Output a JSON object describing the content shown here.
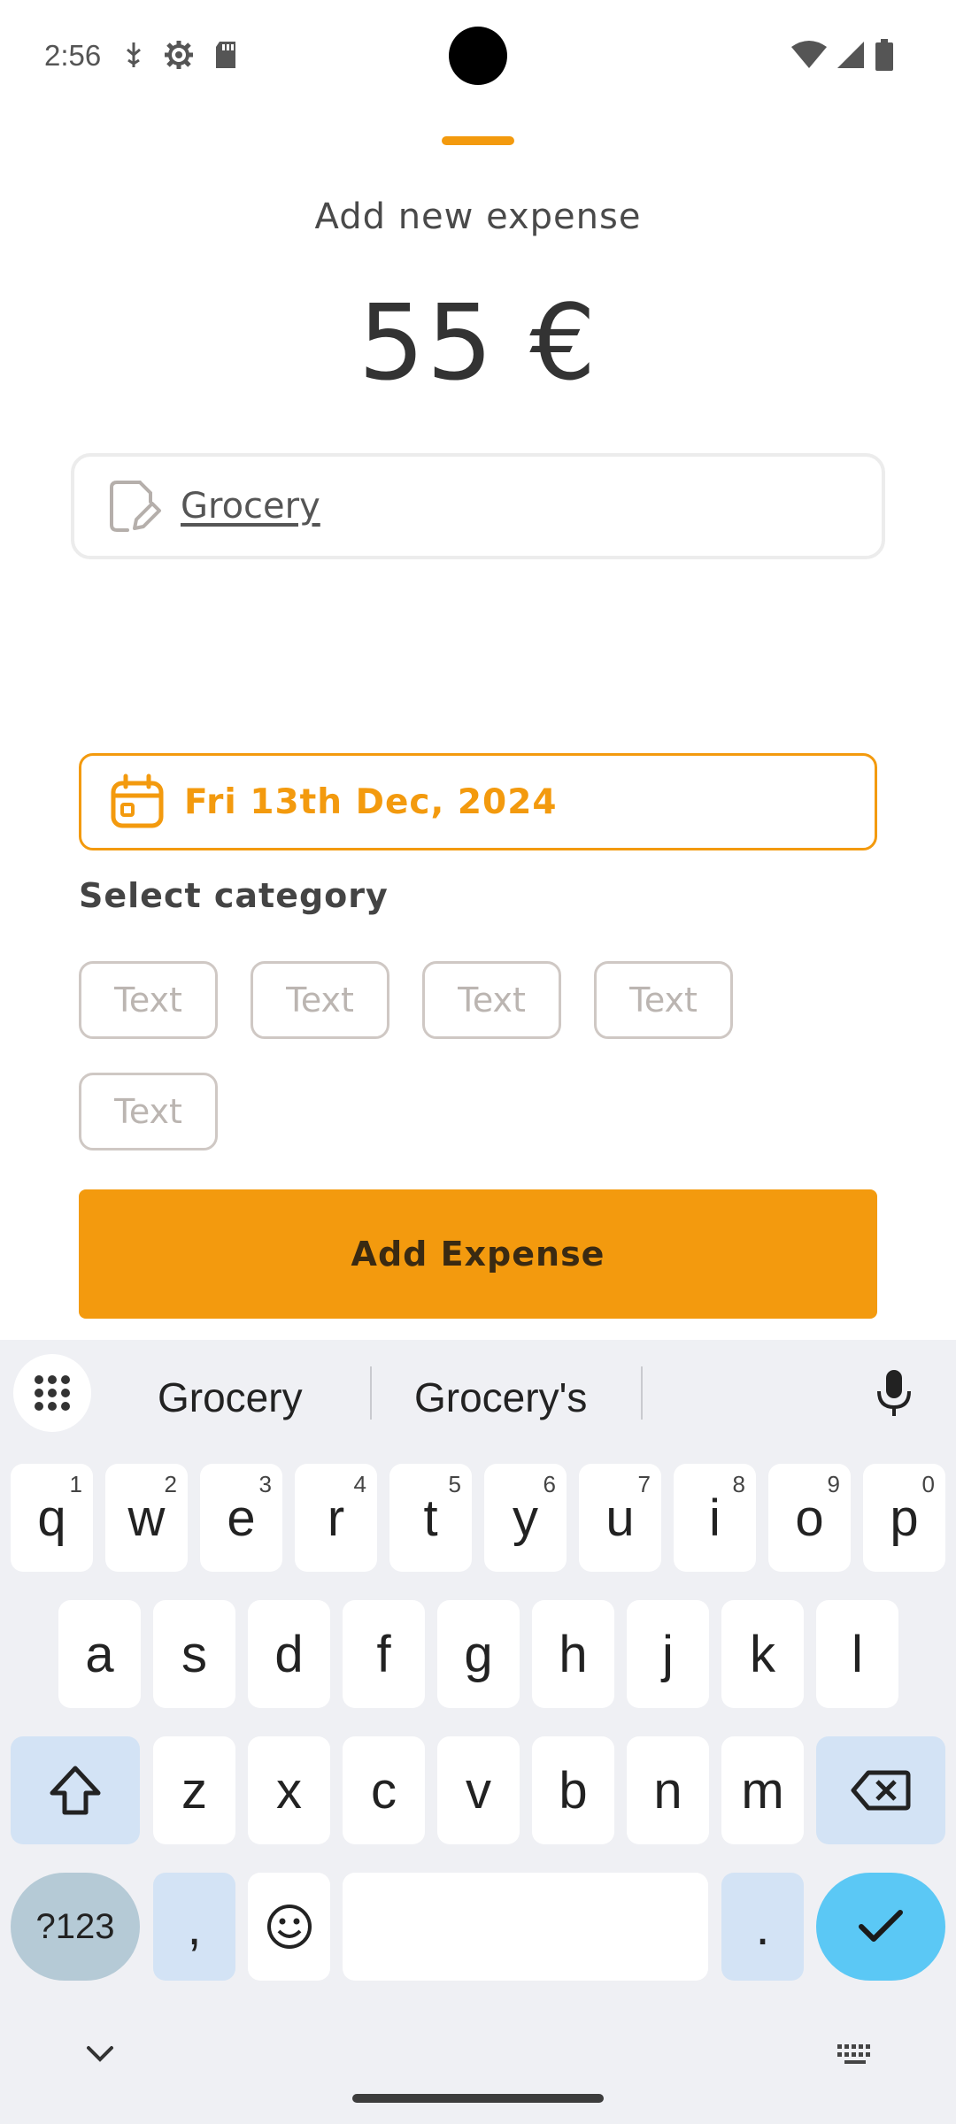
{
  "status_bar": {
    "time": "2:56"
  },
  "sheet": {
    "title": "Add new expense",
    "amount": "55 €",
    "note_value": "Grocery",
    "date": "Fri 13th Dec, 2024",
    "category_label": "Select category",
    "category_chips": [
      "Text",
      "Text",
      "Text",
      "Text",
      "Text"
    ],
    "submit_label": "Add Expense"
  },
  "keyboard": {
    "suggestions": [
      "Grocery",
      "Grocery's"
    ],
    "row1": [
      {
        "key": "q",
        "hint": "1"
      },
      {
        "key": "w",
        "hint": "2"
      },
      {
        "key": "e",
        "hint": "3"
      },
      {
        "key": "r",
        "hint": "4"
      },
      {
        "key": "t",
        "hint": "5"
      },
      {
        "key": "y",
        "hint": "6"
      },
      {
        "key": "u",
        "hint": "7"
      },
      {
        "key": "i",
        "hint": "8"
      },
      {
        "key": "o",
        "hint": "9"
      },
      {
        "key": "p",
        "hint": "0"
      }
    ],
    "row2": [
      "a",
      "s",
      "d",
      "f",
      "g",
      "h",
      "j",
      "k",
      "l"
    ],
    "row3": [
      "z",
      "x",
      "c",
      "v",
      "b",
      "n",
      "m"
    ],
    "symbols_label": "?123",
    "comma": ",",
    "period": "."
  },
  "colors": {
    "accent": "#f39a0e",
    "chip_border": "#cfc8c4",
    "keyboard_bg": "#eff0f4",
    "enter_key": "#5bc8f5"
  },
  "icons": {
    "note": "note-edit-icon",
    "date": "calendar-icon",
    "keyboard_menu": "grid-icon",
    "voice": "mic-icon",
    "shift": "shift-icon",
    "delete": "backspace-icon",
    "emoji": "emoji-icon",
    "enter": "check-icon",
    "hide": "chevron-down-icon",
    "switch": "keyboard-icon"
  }
}
